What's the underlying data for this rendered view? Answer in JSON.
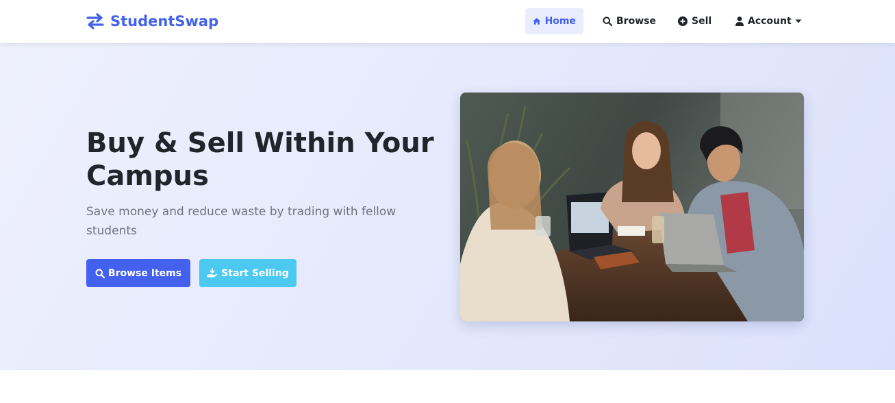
{
  "brand": {
    "name": "StudentSwap",
    "icon": "exchange-arrows-icon",
    "color": "#4361ee"
  },
  "nav": {
    "items": [
      {
        "label": "Home",
        "icon": "home-icon",
        "active": true
      },
      {
        "label": "Browse",
        "icon": "search-icon",
        "active": false
      },
      {
        "label": "Sell",
        "icon": "plus-circle-icon",
        "active": false
      },
      {
        "label": "Account",
        "icon": "user-icon",
        "active": false,
        "dropdown": true
      }
    ]
  },
  "hero": {
    "title": "Buy & Sell Within Your Campus",
    "subtitle": "Save money and reduce waste by trading with fellow students",
    "primary_button": {
      "label": "Browse Items",
      "icon": "search-icon"
    },
    "secondary_button": {
      "label": "Start Selling",
      "icon": "hand-holding-icon"
    },
    "image": {
      "subject": "three students talking with laptops at a cafe table"
    }
  },
  "colors": {
    "primary": "#4361ee",
    "info": "#4cc9f0",
    "text": "#212529",
    "muted": "#6c757d",
    "active_nav_bg": "#e9edfd"
  }
}
